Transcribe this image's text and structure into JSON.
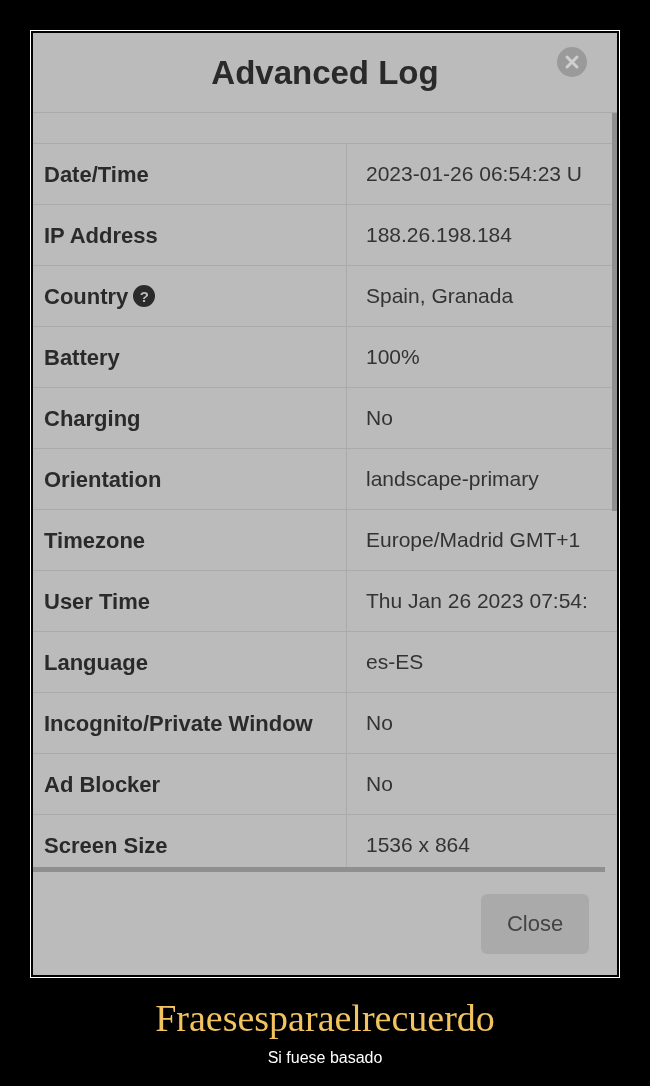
{
  "dialog": {
    "title": "Advanced Log",
    "rows": [
      {
        "label": "Date/Time",
        "value": "2023-01-26 06:54:23 U"
      },
      {
        "label": "IP Address",
        "value": "188.26.198.184"
      },
      {
        "label": "Country",
        "help_icon": "?",
        "value": "Spain, Granada"
      },
      {
        "label": "Battery",
        "value": "100%"
      },
      {
        "label": "Charging",
        "value": "No"
      },
      {
        "label": "Orientation",
        "value": "landscape-primary"
      },
      {
        "label": "Timezone",
        "value": "Europe/Madrid GMT+1"
      },
      {
        "label": "User Time",
        "value": "Thu Jan 26 2023 07:54:"
      },
      {
        "label": "Language",
        "value": "es-ES"
      },
      {
        "label": "Incognito/Private Window",
        "value": "No"
      },
      {
        "label": "Ad Blocker",
        "value": "No"
      },
      {
        "label": "Screen Size",
        "value": "1536 x 864"
      }
    ],
    "close_button": "Close"
  },
  "caption": {
    "title": "Fraesesparaelrecuerdo",
    "subtitle": "Si fuese basado"
  }
}
